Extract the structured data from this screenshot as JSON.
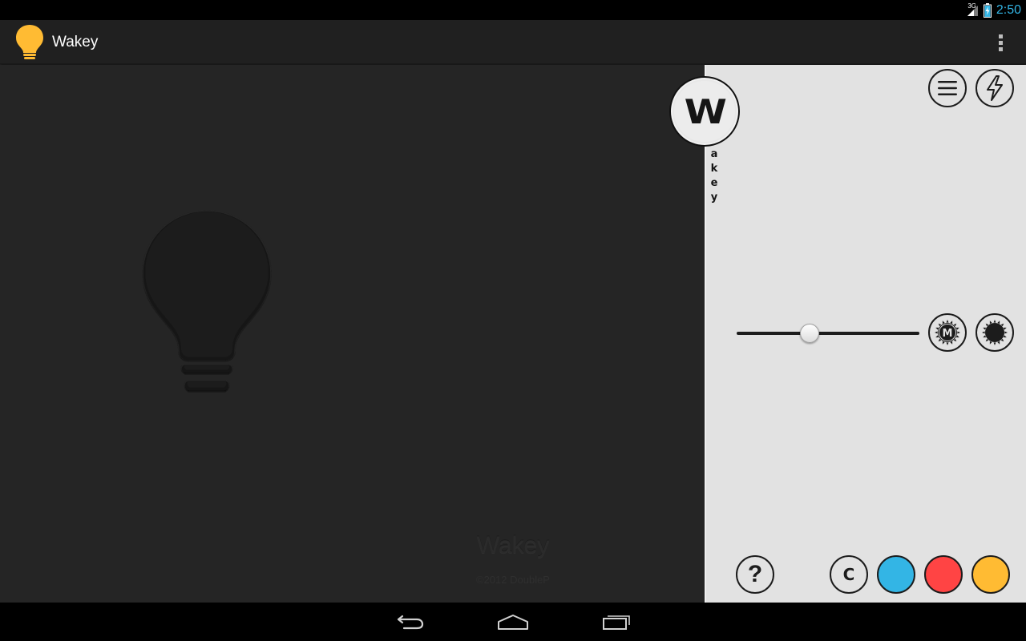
{
  "status_bar": {
    "network_label": "3G",
    "time": "2:50"
  },
  "action_bar": {
    "app_icon": "lightbulb-icon",
    "title": "Wakey",
    "overflow_icon": "overflow-menu-icon"
  },
  "bulb": {
    "icon": "lightbulb-icon",
    "state": "off"
  },
  "about": {
    "title": "Wakey",
    "copyright": "©2012 DoubleP"
  },
  "logo": {
    "letter": "W",
    "tail": [
      "a",
      "k",
      "e",
      "y"
    ]
  },
  "panel": {
    "top_buttons": [
      {
        "name": "menu",
        "icon": "menu-lines-icon"
      },
      {
        "name": "flash",
        "icon": "lightning-icon"
      }
    ],
    "brightness": {
      "value": 0.4,
      "manual_icon": "manual-brightness-icon",
      "manual_label": "M",
      "max_icon": "max-brightness-icon"
    },
    "help_label": "?",
    "custom_color_label": "C",
    "colors": [
      "#33b5e5",
      "#ff4444",
      "#ffbb33"
    ],
    "accent": "#ffbb33"
  },
  "nav_bar": {
    "buttons": [
      "back-icon",
      "home-icon",
      "recents-icon"
    ]
  }
}
